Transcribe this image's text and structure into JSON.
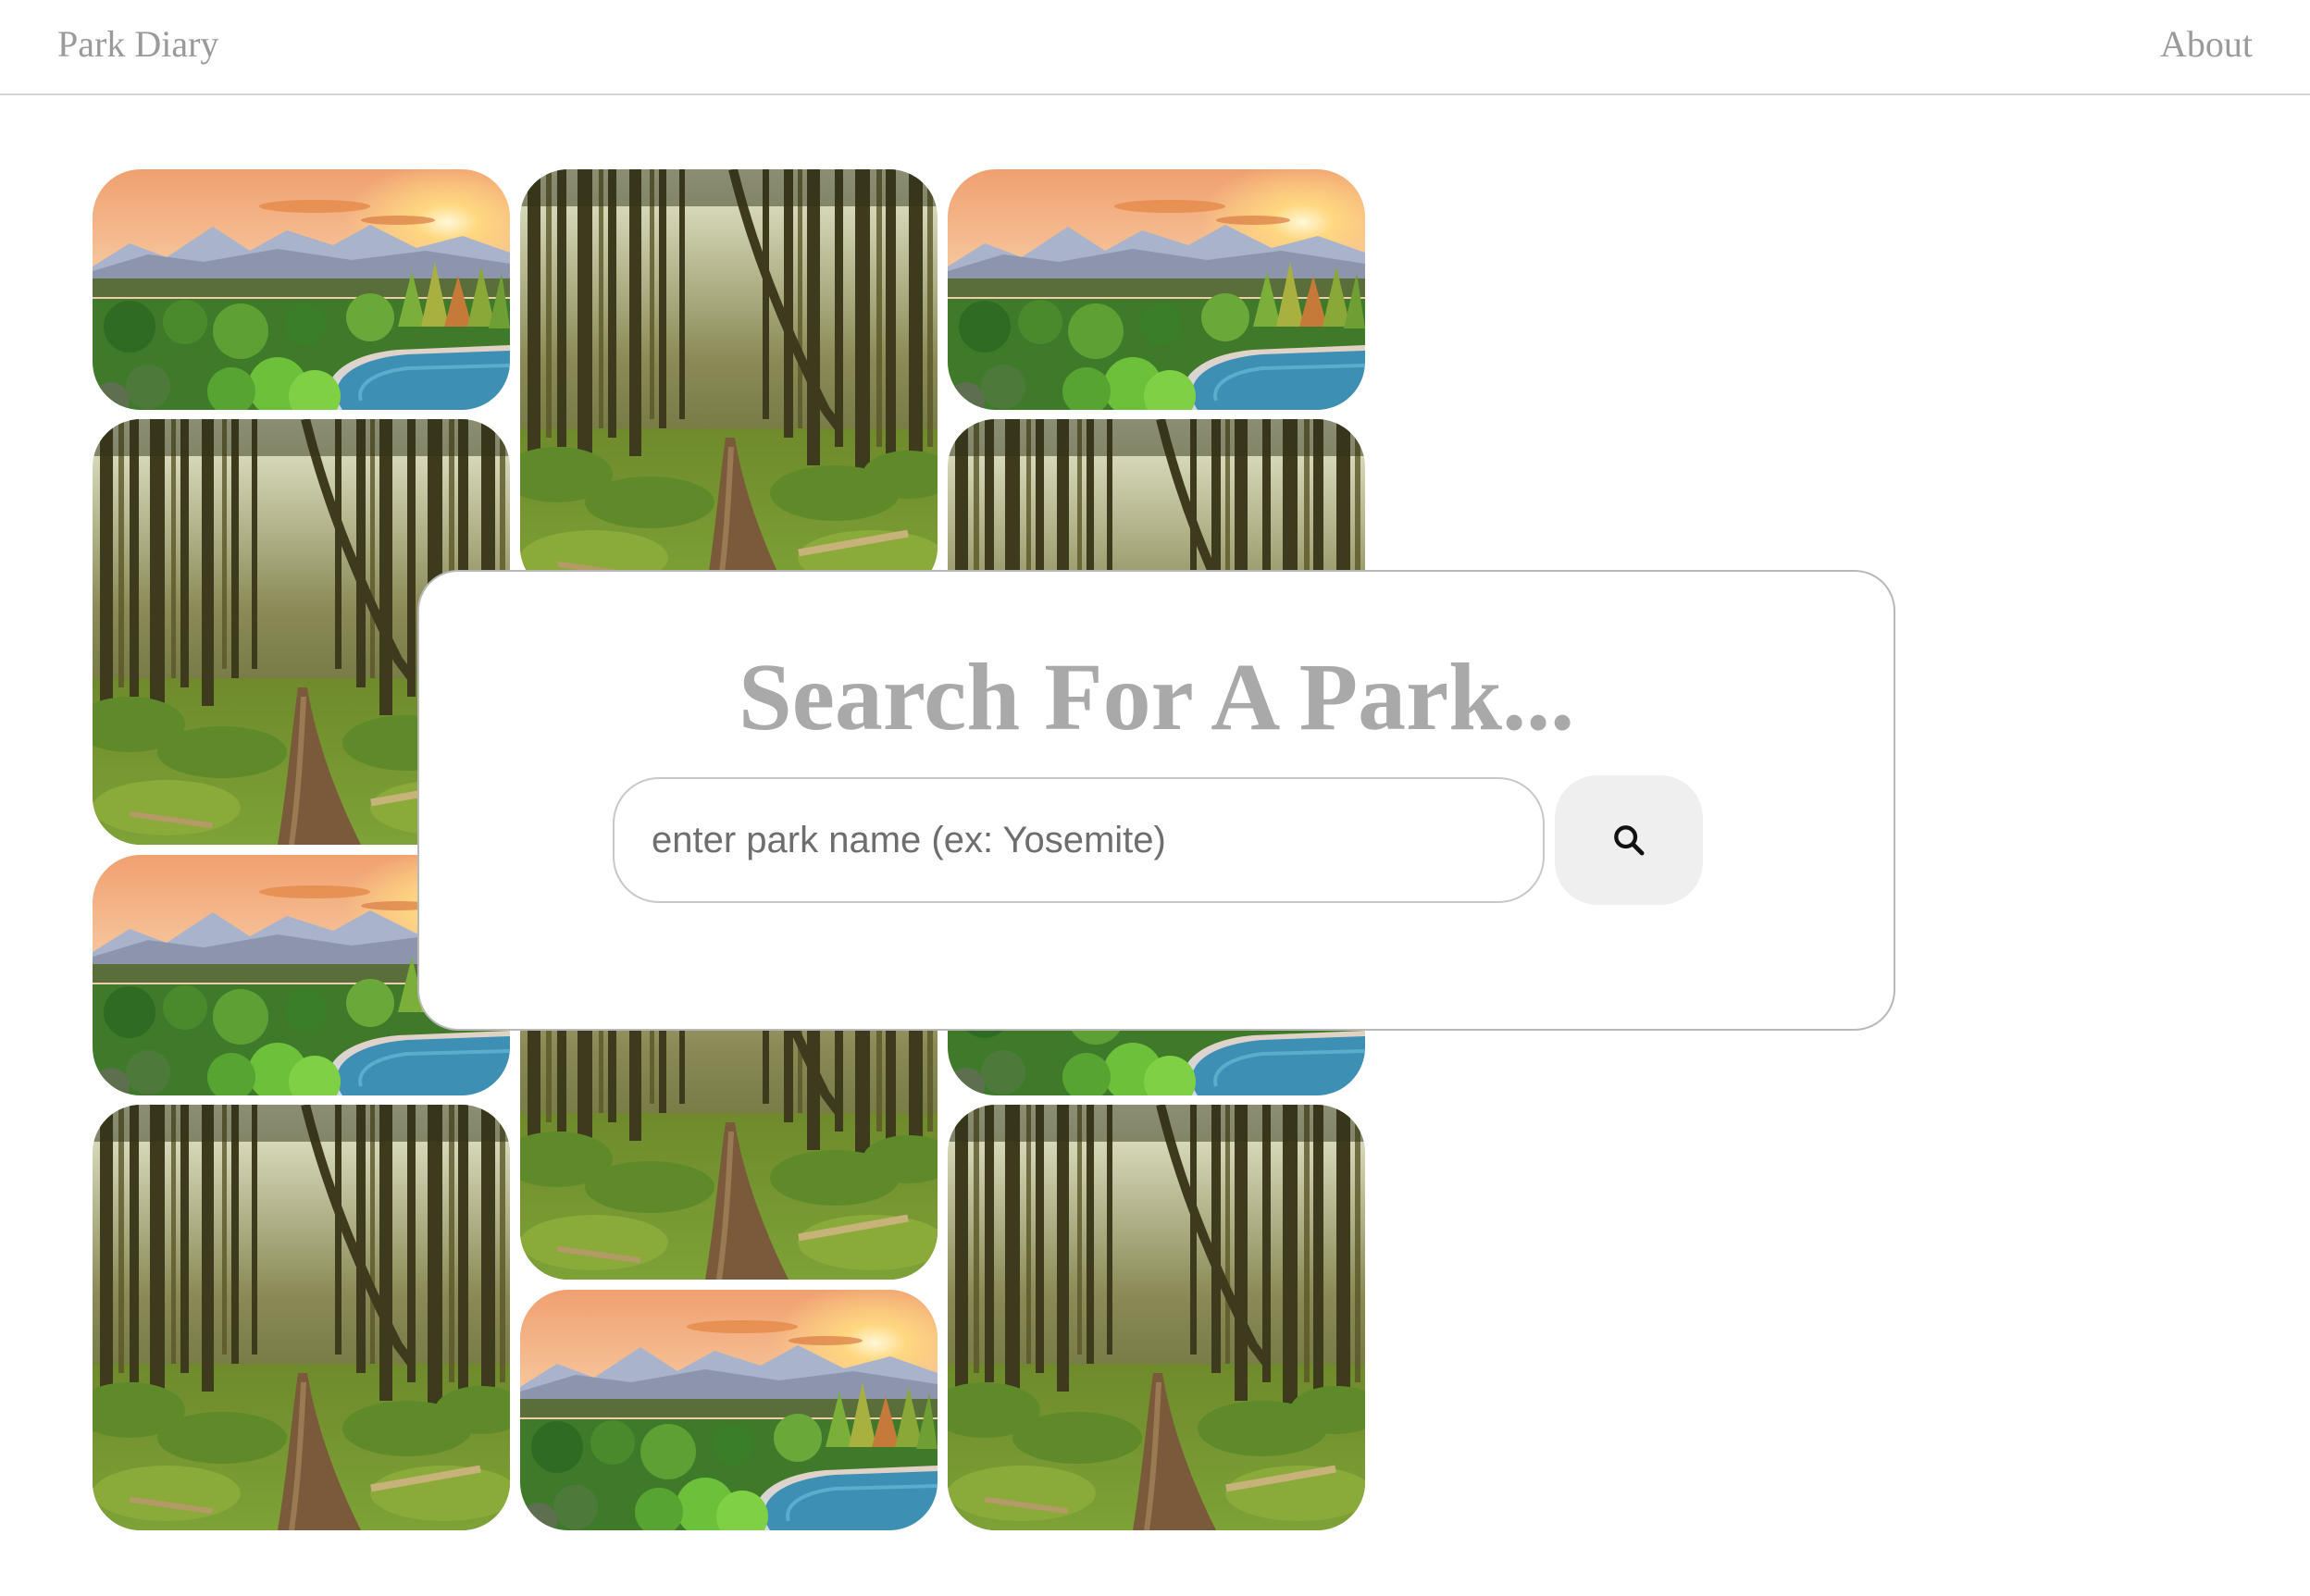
{
  "nav": {
    "brand": "Park Diary",
    "about": "About"
  },
  "gallery": {
    "tiles": [
      {
        "image": "mountain-lake-sunset"
      },
      {
        "image": "forest-trail"
      },
      {
        "image": "mountain-lake-sunset"
      },
      {
        "image": "forest-trail"
      },
      {
        "image": "forest-trail"
      },
      {
        "image": "mountain-lake-sunset"
      },
      {
        "image": "forest-trail"
      },
      {
        "image": "mountain-lake-sunset"
      },
      {
        "image": "forest-trail"
      },
      {
        "image": "forest-trail"
      },
      {
        "image": "mountain-lake-sunset"
      },
      {
        "image": "forest-trail"
      }
    ]
  },
  "search": {
    "title": "Search For A Park...",
    "placeholder": "enter park name (ex: Yosemite)",
    "button_icon": "search-icon"
  },
  "colors": {
    "nav_text": "#9a9a9a",
    "title_text": "#a9a9a9",
    "button_bg": "#efefef"
  }
}
